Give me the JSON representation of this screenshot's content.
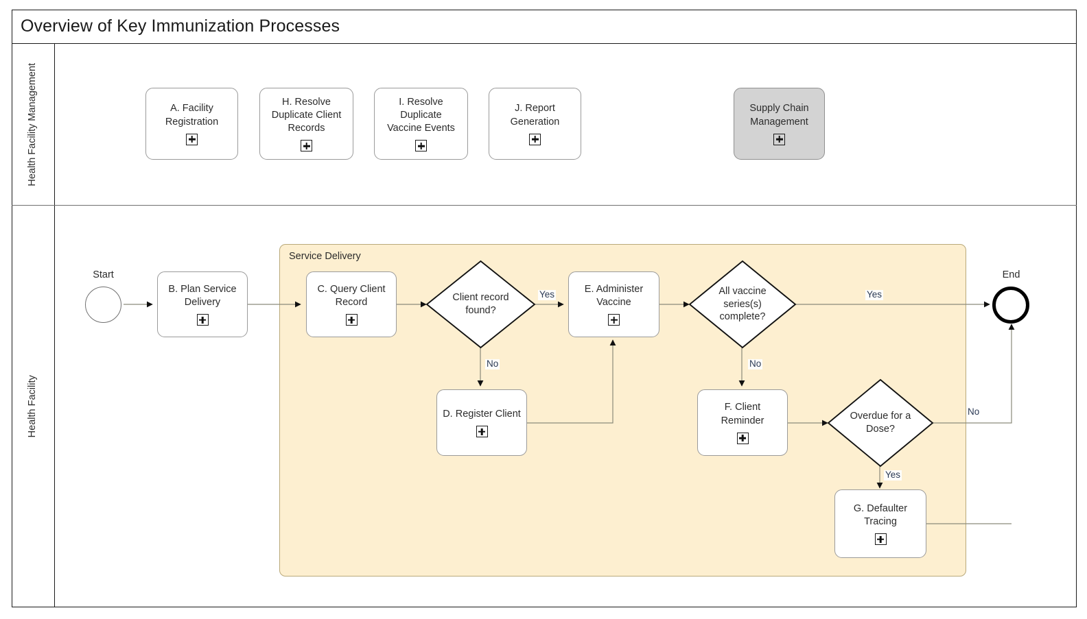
{
  "diagram": {
    "title": "Overview of Key Immunization Processes",
    "type": "bpmn",
    "colors": {
      "pool_border": "#1a1a1a",
      "lane_divider": "#6e6e6e",
      "subprocess_fill": "#fdefd0",
      "subprocess_border": "#b9a97a",
      "task_fill": "#ffffff",
      "task_border": "#9a9a9a",
      "task_shaded_fill": "#d3d3d3",
      "gateway_fill": "#ffffff",
      "gateway_border": "#111111",
      "flow_line": "#8a8a7a",
      "flow_label_text": "#2b3a55",
      "end_event_border": "#000000"
    }
  },
  "lanes": [
    {
      "id": "lane-management",
      "label": "Health Facility\nManagement"
    },
    {
      "id": "lane-facility",
      "label": "Health Facility"
    }
  ],
  "management_tasks": [
    {
      "id": "task-a",
      "label": "A. Facility\nRegistration",
      "marker": "sub-process-plus",
      "shaded": false
    },
    {
      "id": "task-h",
      "label": "H. Resolve\nDuplicate Client\nRecords",
      "marker": "sub-process-plus",
      "shaded": false
    },
    {
      "id": "task-i",
      "label": "I. Resolve Duplicate\nVaccine Events",
      "marker": "sub-process-plus",
      "shaded": false
    },
    {
      "id": "task-j",
      "label": "J. Report\nGeneration",
      "marker": "sub-process-plus",
      "shaded": false
    },
    {
      "id": "task-supply-chain",
      "label": "Supply Chain\nManagement",
      "marker": "sub-process-plus",
      "shaded": true
    }
  ],
  "subprocess": {
    "id": "subprocess-service-delivery",
    "label": "Service Delivery"
  },
  "events": [
    {
      "id": "event-start",
      "type": "start",
      "caption": "Start"
    },
    {
      "id": "event-end",
      "type": "end",
      "caption": "End"
    }
  ],
  "facility_tasks": [
    {
      "id": "task-b",
      "label": "B. Plan Service\nDelivery",
      "marker": "sub-process-plus"
    },
    {
      "id": "task-c",
      "label": "C. Query Client\nRecord",
      "marker": "sub-process-plus"
    },
    {
      "id": "task-d",
      "label": "D. Register Client",
      "marker": "sub-process-plus"
    },
    {
      "id": "task-e",
      "label": "E. Administer\nVaccine",
      "marker": "sub-process-plus"
    },
    {
      "id": "task-f",
      "label": "F. Client Reminder",
      "marker": "sub-process-plus"
    },
    {
      "id": "task-g",
      "label": "G. Defaulter\nTracing",
      "marker": "sub-process-plus"
    }
  ],
  "gateways": [
    {
      "id": "gateway-client-record-found",
      "label": "Client record\nfound?"
    },
    {
      "id": "gateway-series-complete",
      "label": "All vaccine\nseries(s)\ncomplete?"
    },
    {
      "id": "gateway-overdue",
      "label": "Overdue for a\nDose?"
    }
  ],
  "flow_labels": [
    {
      "id": "flow-label-record-found-yes",
      "text": "Yes"
    },
    {
      "id": "flow-label-record-found-no",
      "text": "No"
    },
    {
      "id": "flow-label-series-complete-yes",
      "text": "Yes"
    },
    {
      "id": "flow-label-series-complete-no",
      "text": "No"
    },
    {
      "id": "flow-label-overdue-no",
      "text": "No"
    },
    {
      "id": "flow-label-overdue-yes",
      "text": "Yes"
    }
  ]
}
